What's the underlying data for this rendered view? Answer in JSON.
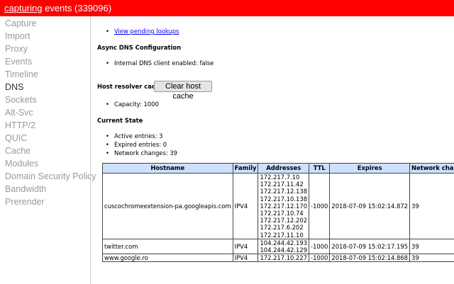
{
  "status_bar": {
    "link_text": "capturing",
    "suffix": " events (339096)"
  },
  "sidebar": {
    "tabs": [
      {
        "label": "Capture",
        "key": "capture"
      },
      {
        "label": "Import",
        "key": "import"
      },
      {
        "label": "Proxy",
        "key": "proxy"
      },
      {
        "label": "Events",
        "key": "events"
      },
      {
        "label": "Timeline",
        "key": "timeline"
      },
      {
        "label": "DNS",
        "key": "dns",
        "active": true
      },
      {
        "label": "Sockets",
        "key": "sockets"
      },
      {
        "label": "Alt-Svc",
        "key": "alt-svc"
      },
      {
        "label": "HTTP/2",
        "key": "http2"
      },
      {
        "label": "QUIC",
        "key": "quic"
      },
      {
        "label": "Cache",
        "key": "cache"
      },
      {
        "label": "Modules",
        "key": "modules"
      },
      {
        "label": "Domain Security Policy",
        "key": "domain-security-policy"
      },
      {
        "label": "Bandwidth",
        "key": "bandwidth"
      },
      {
        "label": "Prerender",
        "key": "prerender"
      }
    ]
  },
  "dns": {
    "pending_link": "View pending lookups",
    "async_heading": "Async DNS Configuration",
    "internal_dns": "Internal DNS client enabled: false",
    "host_cache_label": "Host resolver cache",
    "clear_button": "Clear host cache",
    "capacity": "Capacity: 1000",
    "current_state_heading": "Current State",
    "active_entries": "Active entries: 3",
    "expired_entries": "Expired entries: 0",
    "network_changes": "Network changes: 39",
    "table": {
      "headers": [
        "Hostname",
        "Family",
        "Addresses",
        "TTL",
        "Expires",
        "Network changes"
      ],
      "rows": [
        {
          "hostname": "cuscochromeextension-pa.googleapis.com",
          "family": "IPV4",
          "addresses": [
            "172.217.7.10",
            "172.217.11.42",
            "172.217.12.138",
            "172.217.10.138",
            "172.217.12.170",
            "172.217.10.74",
            "172.217.12.202",
            "172.217.6.202",
            "172.217.11.10"
          ],
          "ttl": "-1000",
          "expires": "2018-07-09 15:02:14.872",
          "network_changes": "39"
        },
        {
          "hostname": "twitter.com",
          "family": "IPV4",
          "addresses": [
            "104.244.42.193",
            "104.244.42.129"
          ],
          "ttl": "-1000",
          "expires": "2018-07-09 15:02:17.195",
          "network_changes": "39"
        },
        {
          "hostname": "www.google.ro",
          "family": "IPV4",
          "addresses": [
            "172.217.10.227"
          ],
          "ttl": "-1000",
          "expires": "2018-07-09 15:02:14.868",
          "network_changes": "39"
        }
      ]
    }
  },
  "colors": {
    "status_bar": "#ff0000",
    "table_header": "#cce0ff",
    "link": "#0000ee"
  }
}
